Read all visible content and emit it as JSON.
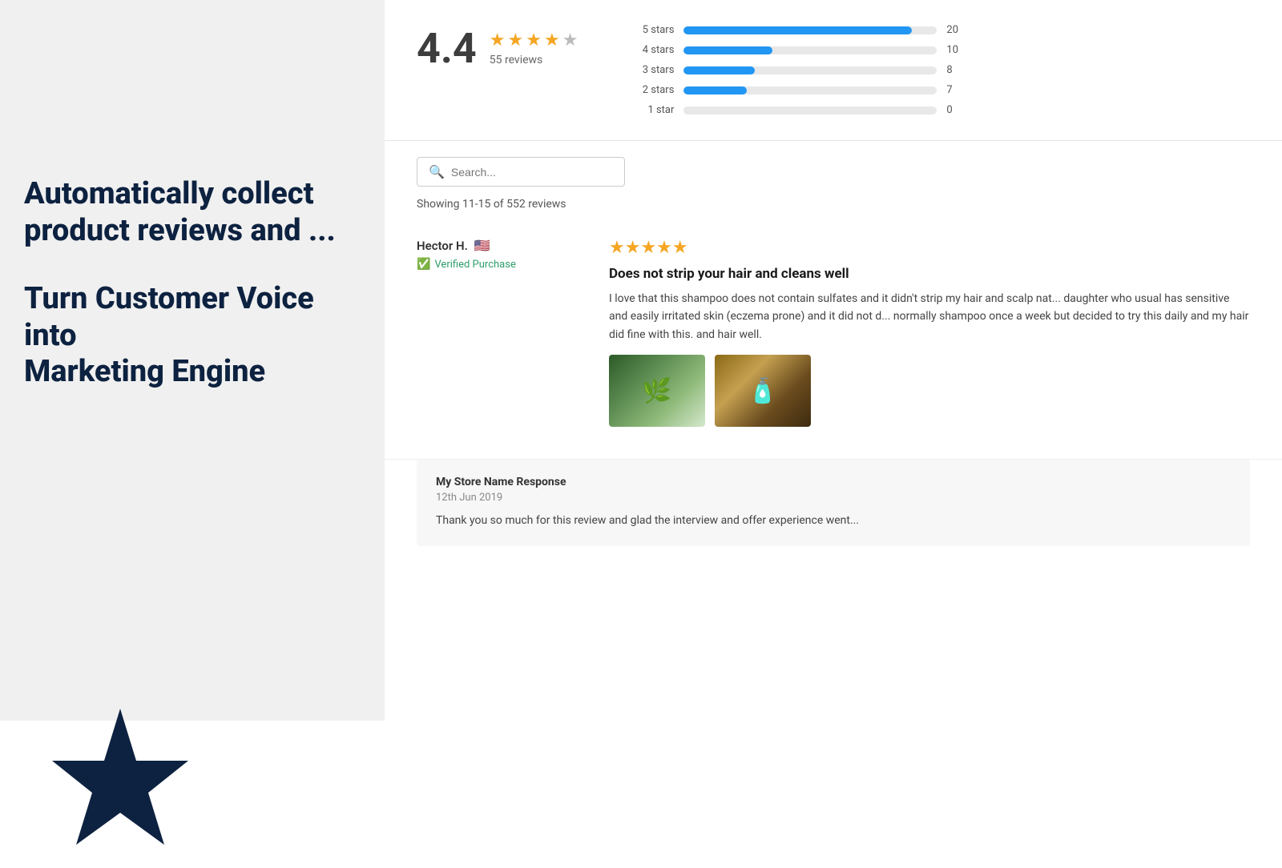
{
  "left": {
    "heading1": "Automatically collect",
    "heading1b": "product reviews and ...",
    "heading2": "Turn Customer Voice into",
    "heading2b": "Marketing Engine"
  },
  "rating": {
    "score": "4.4",
    "review_count": "55 reviews",
    "bars": [
      {
        "label": "5 stars",
        "count": 20,
        "percent": 90
      },
      {
        "label": "4 stars",
        "count": 10,
        "percent": 35
      },
      {
        "label": "3 stars",
        "count": 8,
        "percent": 28
      },
      {
        "label": "2 stars",
        "count": 7,
        "percent": 25
      },
      {
        "label": "1 star",
        "count": 0,
        "percent": 0
      }
    ]
  },
  "search": {
    "placeholder": "Search...",
    "showing": "Showing 11-15 of 552 reviews"
  },
  "reviews": [
    {
      "name": "Hector H.",
      "flag": "🇺🇸",
      "verified": "Verified Purchase",
      "stars": "★★★★★",
      "title": "Does not strip your hair and cleans well",
      "body": "I love that this shampoo does not contain sulfates and it didn't strip my hair and scalp nat... daughter who usual has sensitive and easily irritated skin (eczema prone) and it did not d... normally shampoo once a week but decided to try this daily and my hair did fine with this. and hair well."
    }
  ],
  "store_response": {
    "name": "My Store Name Response",
    "date": "12th Jun 2019",
    "text": "Thank you so much for this review and glad the interview and offer experience went..."
  }
}
